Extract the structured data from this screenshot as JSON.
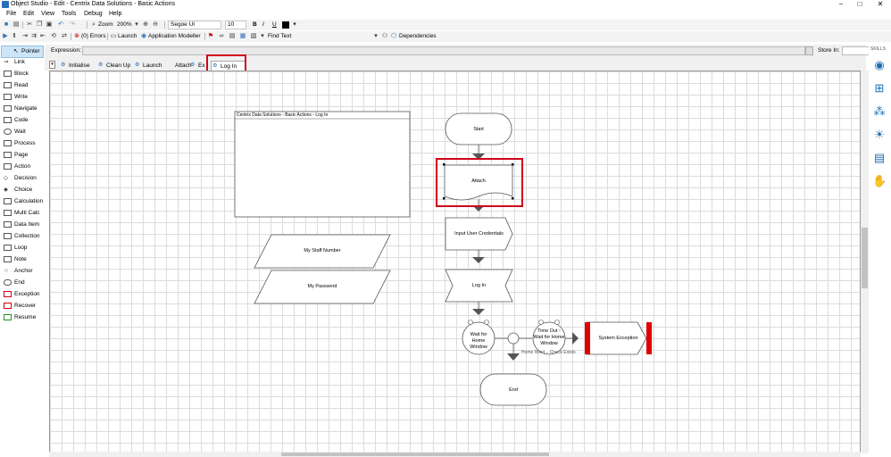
{
  "window": {
    "title": "Object Studio - Edit - Centrix Data Solutions - Basic Actions",
    "minimize": "–",
    "maximize": "□",
    "close": "✕"
  },
  "menu": [
    "File",
    "Edit",
    "View",
    "Tools",
    "Debug",
    "Help"
  ],
  "toolbar1": {
    "zoom_label": "Zoom",
    "zoom_value": "200%",
    "font_name": "Segoe UI",
    "font_size": "10",
    "bold": "B",
    "italic": "I",
    "underline": "U"
  },
  "toolbar2": {
    "errors": "(0) Errors",
    "launch": "Launch",
    "app_modeller": "Application Modeller",
    "find_text": "Find Text",
    "dependencies": "Dependencies"
  },
  "expression": {
    "label": "Expression:",
    "store_in_label": "Store In:"
  },
  "skills_label": "SKILLS",
  "tabs": [
    "Initialise",
    "Clean Up",
    "Launch",
    "Attach",
    "Ex",
    "Log In"
  ],
  "sidebar": [
    "Pointer",
    "Link",
    "Block",
    "Read",
    "Write",
    "Navigate",
    "Code",
    "Wait",
    "Process",
    "Page",
    "Action",
    "Decision",
    "Choice",
    "Calculation",
    "Multi Calc",
    "Data Item",
    "Collection",
    "Loop",
    "Note",
    "Anchor",
    "End",
    "Exception",
    "Recover",
    "Resume"
  ],
  "diagram": {
    "block_title": "Centrix Data Solutions - Basic Actions - Log In",
    "staff_number": "My Staff Number",
    "password": "My Password",
    "start": "Start",
    "attach": "Attach",
    "input_creds": "Input User Credentials",
    "login": "Log In",
    "wait_home": "Wait for Home Window",
    "timeout": "Time Out - Wait for Home Window",
    "home_check": "Home Wind... Check Exists",
    "system_exception": "System Exception",
    "end": "End"
  }
}
